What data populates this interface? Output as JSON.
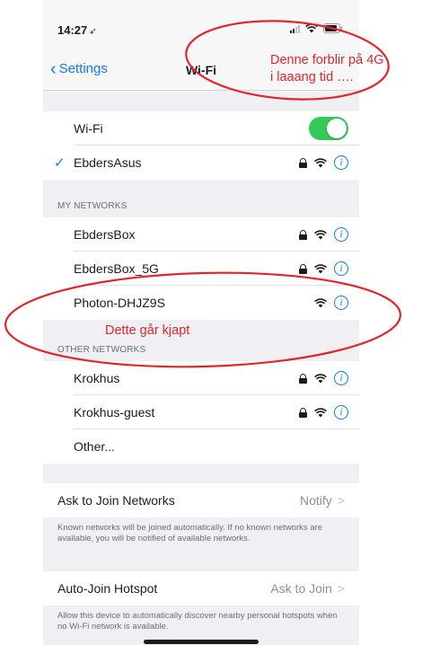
{
  "status_bar": {
    "time": "14:27",
    "location_glyph": "➶"
  },
  "nav": {
    "back_label": "Settings",
    "title": "Wi-Fi"
  },
  "wifi": {
    "label": "Wi-Fi",
    "enabled": true
  },
  "connected": {
    "name": "EbdersAsus"
  },
  "my_networks": {
    "header": "MY NETWORKS",
    "items": [
      {
        "name": "EbdersBox",
        "locked": true
      },
      {
        "name": "EbdersBox_5G",
        "locked": true
      },
      {
        "name": "Photon-DHJZ9S",
        "locked": false
      }
    ]
  },
  "other_networks": {
    "header": "OTHER NETWORKS",
    "items": [
      {
        "name": "Krokhus",
        "locked": true
      },
      {
        "name": "Krokhus-guest",
        "locked": true
      }
    ],
    "other_label": "Other..."
  },
  "ask_to_join": {
    "label": "Ask to Join Networks",
    "value": "Notify",
    "footnote": "Known networks will be joined automatically. If no known networks are available, you will be notified of available networks."
  },
  "auto_join": {
    "label": "Auto-Join Hotspot",
    "value": "Ask to Join",
    "footnote": "Allow this device to automatically discover nearby personal hotspots when no Wi-Fi network is available."
  },
  "annotations": {
    "top_line1": "Denne forblir på 4G",
    "top_line2": "i laaang tid ….",
    "middle": "Dette går kjapt",
    "color": "#e0262a"
  },
  "icons": {
    "lock": "lock-icon",
    "wifi": "wifi-icon",
    "info": "info-icon",
    "checkmark": "checkmark-icon"
  },
  "accent_color": "#0a7aff",
  "toggle_color": "#34c759"
}
